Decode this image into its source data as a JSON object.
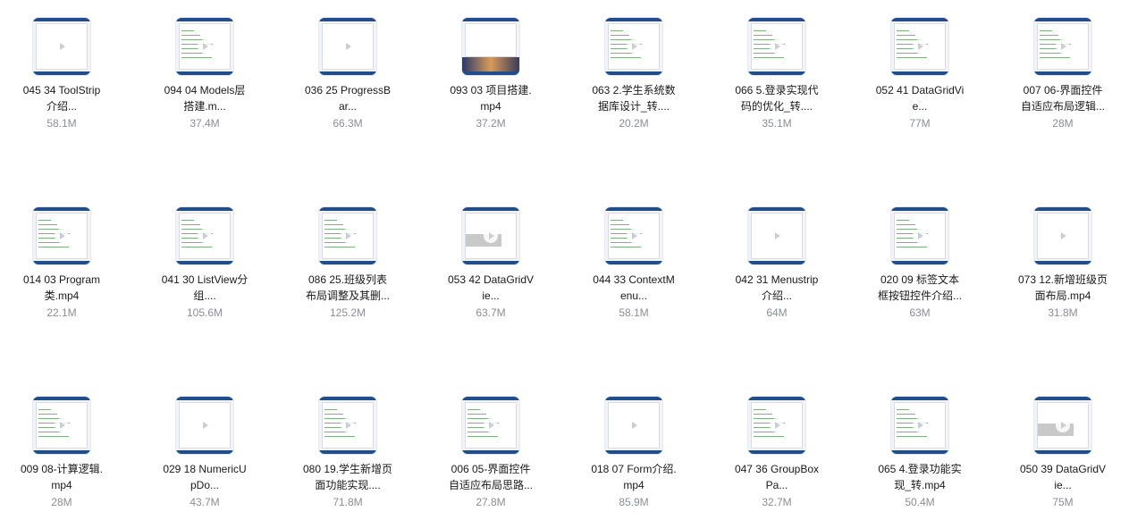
{
  "files": [
    {
      "line1": "045 34 ToolStrip",
      "line2": "介绍...",
      "size": "58.1M",
      "thumb": "player"
    },
    {
      "line1": "094 04 Models层",
      "line2": "搭建.m...",
      "size": "37.4M",
      "thumb": "code"
    },
    {
      "line1": "036 25 ProgressB",
      "line2": "ar...",
      "size": "66.3M",
      "thumb": "player"
    },
    {
      "line1": "093 03 项目搭建.",
      "line2": "mp4",
      "size": "37.2M",
      "thumb": "sunset"
    },
    {
      "line1": "063 2.学生系统数",
      "line2": "据库设计_转....",
      "size": "20.2M",
      "thumb": "code"
    },
    {
      "line1": "066 5.登录实现代",
      "line2": "码的优化_转....",
      "size": "35.1M",
      "thumb": "code"
    },
    {
      "line1": "052 41 DataGridVi",
      "line2": "e...",
      "size": "77M",
      "thumb": "code"
    },
    {
      "line1": "007 06-界面控件",
      "line2": "自适应布局逻辑...",
      "size": "28M",
      "thumb": "code"
    },
    {
      "line1": "014 03 Program",
      "line2": "类.mp4",
      "size": "22.1M",
      "thumb": "code"
    },
    {
      "line1": "041 30 ListView分",
      "line2": "组....",
      "size": "105.6M",
      "thumb": "code"
    },
    {
      "line1": "086 25.班级列表",
      "line2": "布局调整及其删...",
      "size": "125.2M",
      "thumb": "code"
    },
    {
      "line1": "053 42 DataGridV",
      "line2": "ie...",
      "size": "63.7M",
      "thumb": "gray"
    },
    {
      "line1": "044 33 ContextM",
      "line2": "enu...",
      "size": "58.1M",
      "thumb": "code"
    },
    {
      "line1": "042 31 Menustrip",
      "line2": "介绍...",
      "size": "64M",
      "thumb": "player"
    },
    {
      "line1": "020 09 标签文本",
      "line2": "框按钮控件介绍...",
      "size": "63M",
      "thumb": "code"
    },
    {
      "line1": "073 12.新增班级页",
      "line2": "面布局.mp4",
      "size": "31.8M",
      "thumb": "player"
    },
    {
      "line1": "009 08-计算逻辑.",
      "line2": "mp4",
      "size": "28M",
      "thumb": "code"
    },
    {
      "line1": "029 18 NumericU",
      "line2": "pDo...",
      "size": "43.7M",
      "thumb": "player"
    },
    {
      "line1": "080 19.学生新增页",
      "line2": "面功能实现....",
      "size": "71.8M",
      "thumb": "code"
    },
    {
      "line1": "006 05-界面控件",
      "line2": "自适应布局思路...",
      "size": "27.8M",
      "thumb": "code"
    },
    {
      "line1": "018 07 Form介绍.",
      "line2": "mp4",
      "size": "85.9M",
      "thumb": "player"
    },
    {
      "line1": "047 36 GroupBox",
      "line2": "Pa...",
      "size": "32.7M",
      "thumb": "code"
    },
    {
      "line1": "065 4.登录功能实",
      "line2": "现_转.mp4",
      "size": "50.4M",
      "thumb": "code"
    },
    {
      "line1": "050 39 DataGridV",
      "line2": "ie...",
      "size": "75M",
      "thumb": "gray"
    }
  ]
}
